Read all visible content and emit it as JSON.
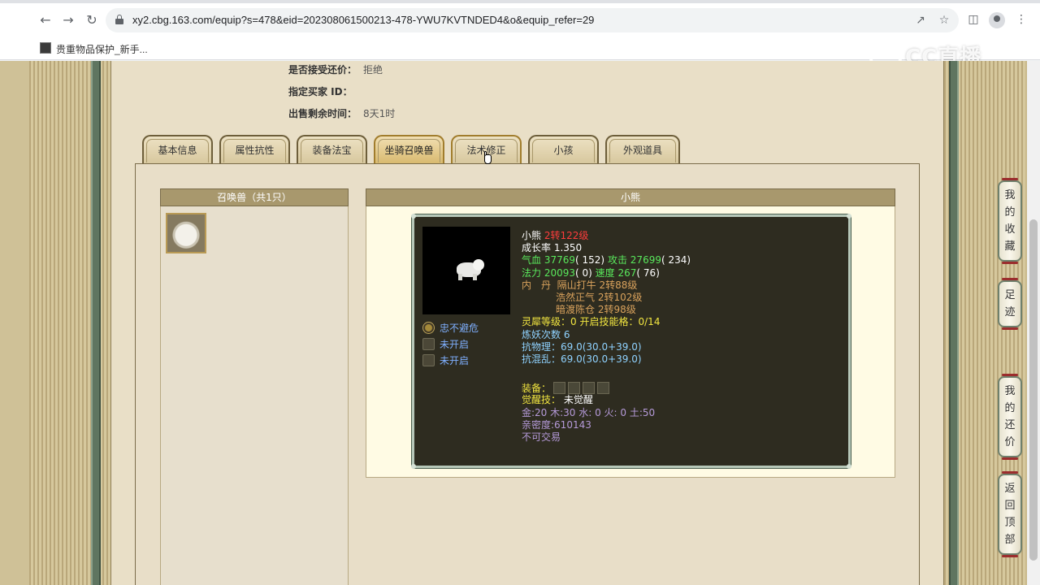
{
  "browser": {
    "url": "xy2.cbg.163.com/equip?s=478&eid=202308061500213-478-YWU7KVTNDED4&o&equip_refer=29",
    "bookmark_label": "贵重物品保护_新手...",
    "watermark_text": "CC直播"
  },
  "info": {
    "rows": [
      {
        "label": "是否接受还价：",
        "value": "拒绝"
      },
      {
        "label": "指定买家 ID：",
        "value": ""
      },
      {
        "label": "出售剩余时间：",
        "value": "8天1时"
      }
    ]
  },
  "tabs": [
    {
      "label": "基本信息"
    },
    {
      "label": "属性抗性"
    },
    {
      "label": "装备法宝"
    },
    {
      "label": "坐骑召唤兽"
    },
    {
      "label": "法术修正"
    },
    {
      "label": "小孩"
    },
    {
      "label": "外观道具"
    }
  ],
  "summon_list": {
    "header": "召唤兽（共1只）"
  },
  "pet_detail": {
    "header": "小熊",
    "name": "小熊",
    "level": "2转122级",
    "growth": "成长率 1.350",
    "hp_label": "气血",
    "hp": "37769",
    "hp_extra": "( 152)",
    "atk_label": "攻击",
    "atk": "27699",
    "atk_extra": "( 234)",
    "mp_label": "法力",
    "mp": "20093",
    "mp_extra": "( 0)",
    "spd_label": "速度",
    "spd": "267",
    "spd_extra": "( 76)",
    "neidan_label": "内　丹",
    "neidan": [
      "隔山打牛 2转88级",
      "浩然正气 2转102级",
      "暗渡陈仓 2转98级"
    ],
    "lingxi_label": "灵犀等级：",
    "lingxi_value": "0",
    "lingxi_skill_label": "开启技能格：",
    "lingxi_skill_value": "0/14",
    "lianyao": "炼妖次数 6",
    "resist_phys": "抗物理：69.0(30.0+39.0)",
    "resist_chaos": "抗混乱：69.0(30.0+39.0)",
    "equip_label": "装备：",
    "awaken_label": "觉醒技：",
    "awaken_value": "未觉醒",
    "elements": "金:20 木:30 水: 0 火: 0 土:50",
    "intimacy": "亲密度:610143",
    "trade": "不可交易",
    "skills": [
      "忠不避危",
      "未开启",
      "未开启"
    ]
  },
  "side_nav": [
    {
      "label": "我的收藏"
    },
    {
      "label": "足迹"
    },
    {
      "label": "我的还价"
    },
    {
      "label": "返回顶部"
    }
  ]
}
